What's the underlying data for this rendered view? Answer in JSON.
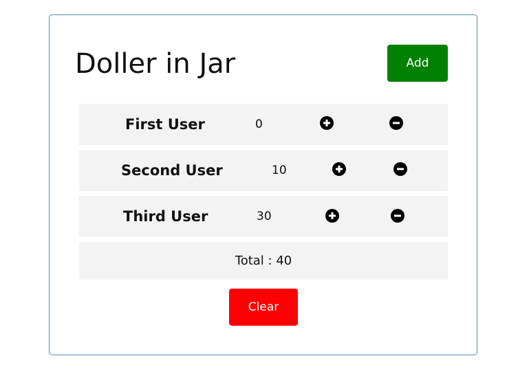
{
  "app": {
    "title": "Doller in Jar",
    "add_label": "Add",
    "clear_label": "Clear",
    "total_prefix": "Total : ",
    "total_value": "40"
  },
  "users": [
    {
      "name": "First User",
      "amount": "0"
    },
    {
      "name": "Second User",
      "amount": "10"
    },
    {
      "name": "Third User",
      "amount": "30"
    }
  ],
  "icons": {
    "increment": "plus-circle-icon",
    "decrement": "minus-circle-icon"
  },
  "colors": {
    "add_button": "#008000",
    "clear_button": "#ff0000",
    "row_background": "#f3f3f3",
    "card_border": "#4f8ea8"
  }
}
